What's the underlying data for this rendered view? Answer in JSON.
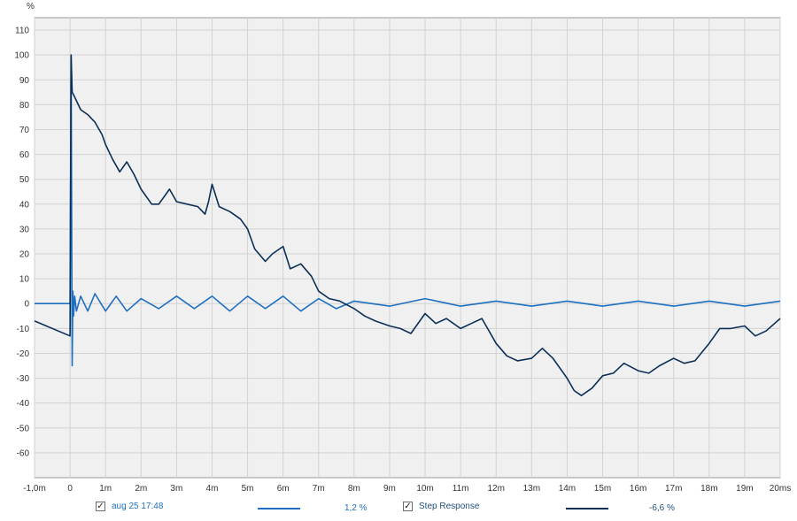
{
  "chart_data": {
    "type": "line",
    "ylabel": "%",
    "xlim": [
      -1.0,
      20.0
    ],
    "ylim": [
      -70,
      115
    ],
    "grid": true,
    "x_ticks": [
      "-1,0m",
      "0",
      "1m",
      "2m",
      "3m",
      "4m",
      "5m",
      "6m",
      "7m",
      "8m",
      "9m",
      "10m",
      "11m",
      "12m",
      "13m",
      "14m",
      "15m",
      "16m",
      "17m",
      "18m",
      "19m",
      "20ms"
    ],
    "y_ticks": [
      "110",
      "100",
      "90",
      "80",
      "70",
      "60",
      "50",
      "40",
      "30",
      "20",
      "10",
      "0",
      "-10",
      "-20",
      "-30",
      "-40",
      "-50",
      "-60"
    ],
    "series": [
      {
        "name": "aug 25 17:48",
        "color": "#1f6fc0",
        "value_label": "1,2 %",
        "x": [
          -1.0,
          -0.05,
          0.0,
          0.03,
          0.06,
          0.08,
          0.1,
          0.13,
          0.18,
          0.3,
          0.5,
          0.7,
          1.0,
          1.3,
          1.6,
          2.0,
          2.5,
          3.0,
          3.5,
          4.0,
          4.5,
          5.0,
          5.5,
          6.0,
          6.5,
          7.0,
          7.5,
          8.0,
          9.0,
          10.0,
          11.0,
          12.0,
          13.0,
          14.0,
          15.0,
          16.0,
          17.0,
          18.0,
          19.0,
          20.0
        ],
        "y": [
          0,
          0,
          0,
          100,
          -25,
          5,
          -5,
          3,
          -3,
          3,
          -3,
          4,
          -3,
          3,
          -3,
          2,
          -2,
          3,
          -2,
          3,
          -3,
          3,
          -2,
          3,
          -3,
          2,
          -2,
          1,
          -1,
          2,
          -1,
          1,
          -1,
          1,
          -1,
          1,
          -1,
          1,
          -1,
          1
        ]
      },
      {
        "name": "Step Response",
        "color": "#0b2f57",
        "value_label": "-6,6 %",
        "x": [
          -1.0,
          0.0,
          0.03,
          0.06,
          0.1,
          0.3,
          0.5,
          0.7,
          0.9,
          1.0,
          1.2,
          1.4,
          1.6,
          1.8,
          2.0,
          2.3,
          2.5,
          2.8,
          3.0,
          3.3,
          3.6,
          3.8,
          3.9,
          4.0,
          4.2,
          4.5,
          4.8,
          5.0,
          5.2,
          5.5,
          5.7,
          6.0,
          6.2,
          6.5,
          6.8,
          7.0,
          7.3,
          7.6,
          8.0,
          8.3,
          8.6,
          9.0,
          9.3,
          9.6,
          10.0,
          10.3,
          10.6,
          11.0,
          11.3,
          11.6,
          12.0,
          12.3,
          12.6,
          13.0,
          13.3,
          13.6,
          14.0,
          14.2,
          14.4,
          14.7,
          15.0,
          15.3,
          15.6,
          16.0,
          16.3,
          16.6,
          17.0,
          17.3,
          17.6,
          18.0,
          18.3,
          18.6,
          19.0,
          19.3,
          19.6,
          20.0
        ],
        "y": [
          -7,
          -13,
          100,
          85,
          84,
          78,
          76,
          73,
          68,
          64,
          58,
          53,
          57,
          52,
          46,
          40,
          40,
          46,
          41,
          40,
          39,
          36,
          41,
          48,
          39,
          37,
          34,
          30,
          22,
          17,
          20,
          23,
          14,
          16,
          11,
          5,
          2,
          1,
          -2,
          -5,
          -7,
          -9,
          -10,
          -12,
          -4,
          -8,
          -6,
          -10,
          -8,
          -6,
          -16,
          -21,
          -23,
          -22,
          -18,
          -22,
          -30,
          -35,
          -37,
          -34,
          -29,
          -28,
          -24,
          -27,
          -28,
          -25,
          -22,
          -24,
          -23,
          -16,
          -10,
          -10,
          -9,
          -13,
          -11,
          -6
        ]
      }
    ]
  },
  "legend": {
    "items": [
      {
        "checked_glyph": "✓",
        "label": "aug 25 17:48",
        "value": "1,2 %"
      },
      {
        "checked_glyph": "✓",
        "label": "Step Response",
        "value": "-6,6 %"
      }
    ]
  }
}
